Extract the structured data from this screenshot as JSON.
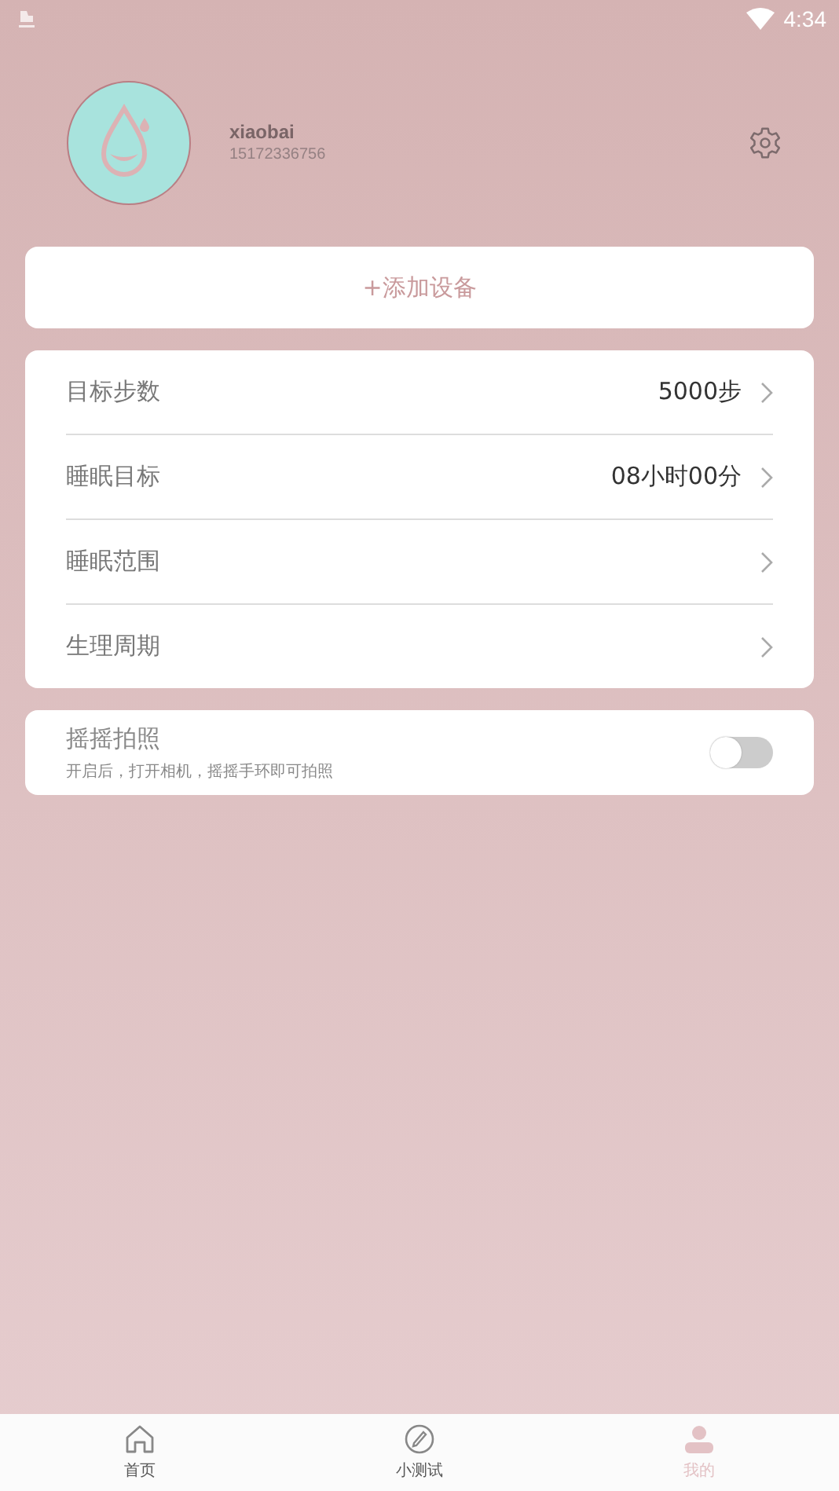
{
  "status_bar": {
    "time": "4:34"
  },
  "profile": {
    "name": "xiaobai",
    "phone": "15172336756"
  },
  "add_device": {
    "label": "+添加设备"
  },
  "settings": [
    {
      "label": "目标步数",
      "value": "5000步"
    },
    {
      "label": "睡眠目标",
      "value": "08小时00分"
    },
    {
      "label": "睡眠范围"
    },
    {
      "label": "生理周期"
    }
  ],
  "shake_photo": {
    "title": "摇摇拍照",
    "description": "开启后，打开相机，摇摇手环即可拍照",
    "on": false
  },
  "nav": [
    {
      "label": "首页",
      "selected": false
    },
    {
      "label": "小测试",
      "selected": false
    },
    {
      "label": "我的",
      "selected": true
    }
  ]
}
